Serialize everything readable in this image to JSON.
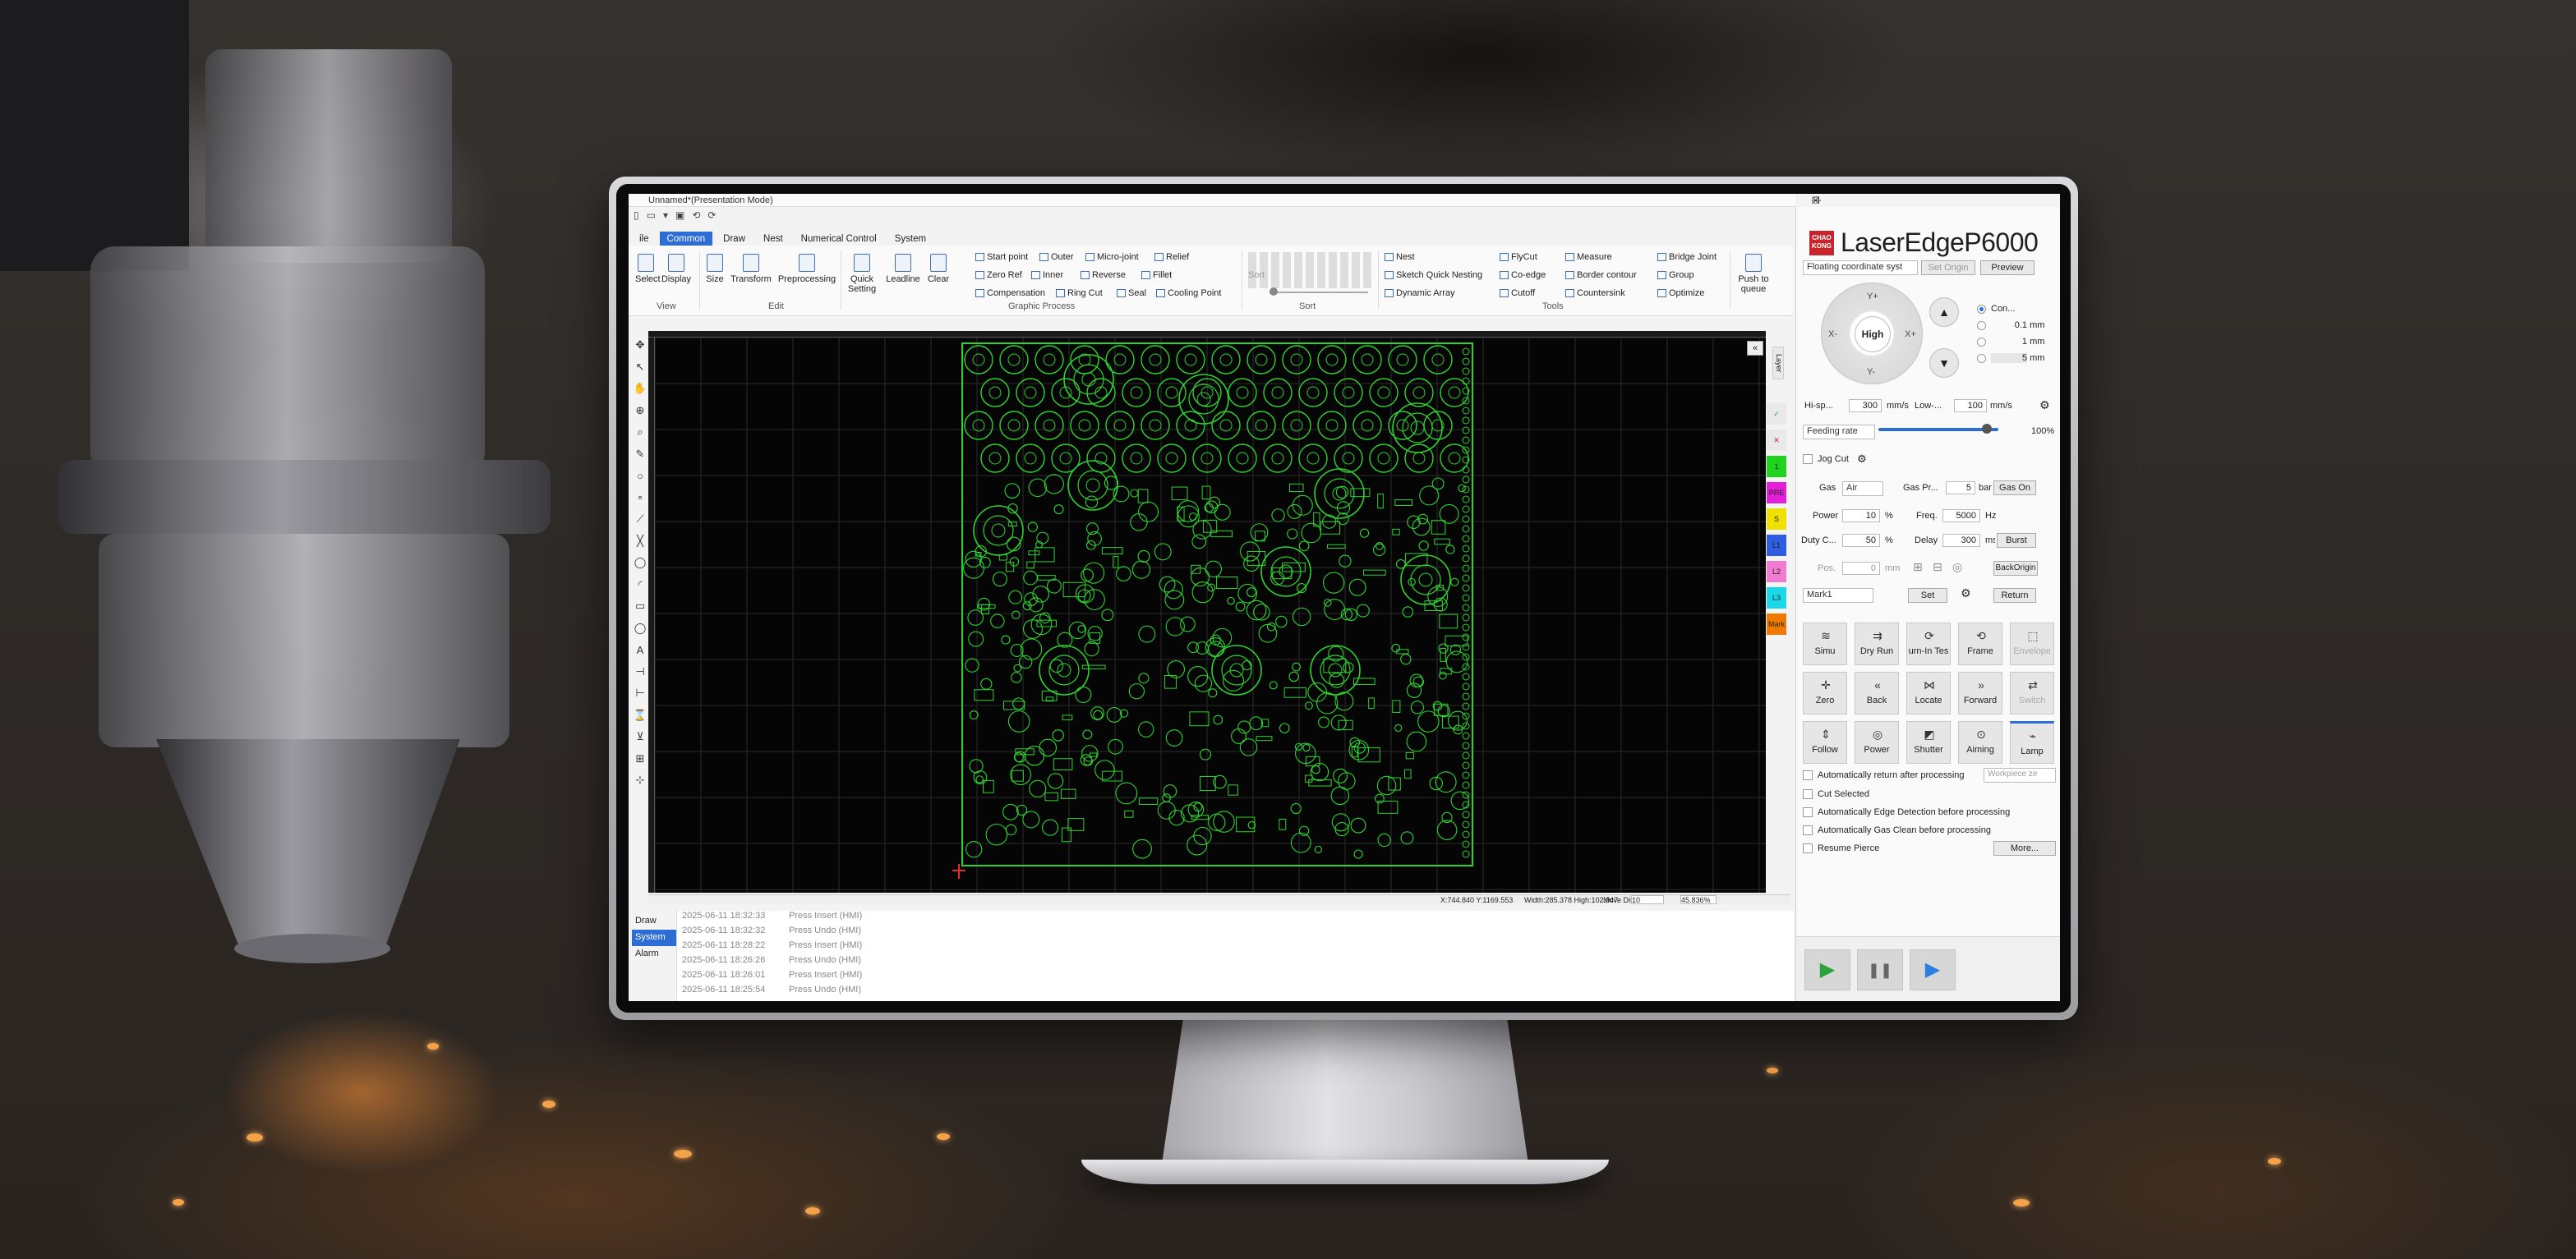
{
  "window": {
    "title": "Unnamed*(Presentation Mode)",
    "controls": [
      "—",
      "❐",
      "✕"
    ]
  },
  "quick_access": [
    "▯",
    "▭",
    "▾",
    "▣",
    "⟲",
    "⟳"
  ],
  "tabs": [
    {
      "label": "ile",
      "active": false
    },
    {
      "label": "Common",
      "active": true
    },
    {
      "label": "Draw",
      "active": false
    },
    {
      "label": "Nest",
      "active": false
    },
    {
      "label": "Numerical Control",
      "active": false
    },
    {
      "label": "System",
      "active": false
    }
  ],
  "ribbon": {
    "groups": {
      "view": "View",
      "edit": "Edit",
      "graphic_process": "Graphic Process",
      "sort": "Sort",
      "tools": "Tools"
    },
    "view": {
      "select": "Select",
      "display": "Display"
    },
    "edit": {
      "size": "Size",
      "transform": "Transform",
      "preprocessing": "Preprocessing"
    },
    "gp": {
      "quick_setting": "Quick Setting",
      "leadline": "Leadline",
      "clear": "Clear",
      "start_point": "Start point",
      "outer": "Outer",
      "micro_joint": "Micro-joint",
      "relief": "Relief",
      "zero_ref": "Zero Ref",
      "inner": "Inner",
      "reverse": "Reverse",
      "fillet": "Fillet",
      "compensation": "Compensation",
      "ring_cut": "Ring Cut",
      "seal": "Seal",
      "cooling_point": "Cooling Point"
    },
    "sort": {
      "label": "Sort"
    },
    "tools": {
      "nest": "Nest",
      "sketch_quick_nesting": "Sketch Quick Nesting",
      "dynamic_array": "Dynamic Array",
      "flycut": "FlyCut",
      "co_edge": "Co-edge",
      "cutoff": "Cutoff",
      "measure": "Measure",
      "border_contour": "Border contour",
      "countersink": "Countersink",
      "bridge_joint": "Bridge Joint",
      "group": "Group",
      "optimize": "Optimize"
    },
    "push_to_queue": "Push to queue"
  },
  "left_tools": [
    "✥",
    "↖",
    "✋",
    "⊕",
    "⌕",
    "✎",
    "○",
    "∘",
    "⟋",
    "╳",
    "◯",
    "◜",
    "▭",
    "◯",
    "A",
    "⊣",
    "⊢",
    "⌛",
    "⊻",
    "⊞",
    "⊹"
  ],
  "layers": [
    {
      "label": "✓",
      "color": "#e9e9e9",
      "text": "#2ca02c"
    },
    {
      "label": "✕",
      "color": "#e9e9e9",
      "text": "#d62728"
    },
    {
      "label": "1",
      "color": "#1fd31f",
      "text": "#222"
    },
    {
      "label": "PRE",
      "color": "#e320d8",
      "text": "#222"
    },
    {
      "label": "S",
      "color": "#f0e000",
      "text": "#222"
    },
    {
      "label": "L1",
      "color": "#2f5de0",
      "text": "#222"
    },
    {
      "label": "L2",
      "color": "#f07bd0",
      "text": "#222"
    },
    {
      "label": "L3",
      "color": "#1ad8e8",
      "text": "#222"
    },
    {
      "label": "Mark",
      "color": "#f07a00",
      "text": "#222"
    }
  ],
  "layer_tab": "Layer",
  "canvas": {
    "close_icon": "«",
    "pattern_color": "#2fd32f",
    "grid_color": "#2a2a2a"
  },
  "status_bar": {
    "coords": "X:744.840 Y:1169.553",
    "size": "Width:285.378 High:102.947",
    "move_dis_label": "Move Dis",
    "move_dis_value": "10",
    "zoom": "45.836%"
  },
  "log": {
    "tabs": [
      {
        "label": "Draw",
        "active": false
      },
      {
        "label": "System",
        "active": true
      },
      {
        "label": "Alarm",
        "active": false
      }
    ],
    "rows": [
      {
        "time": "2025-06-11 18:32:33",
        "msg": "Press Insert (HMI)"
      },
      {
        "time": "2025-06-11 18:32:32",
        "msg": "Press Undo (HMI)"
      },
      {
        "time": "2025-06-11 18:28:22",
        "msg": "Press Insert (HMI)"
      },
      {
        "time": "2025-06-11 18:26:26",
        "msg": "Press Undo (HMI)"
      },
      {
        "time": "2025-06-11 18:26:01",
        "msg": "Press Insert (HMI)"
      },
      {
        "time": "2025-06-11 18:25:54",
        "msg": "Press Undo (HMI)"
      }
    ]
  },
  "panel": {
    "logo_mark": "CHAO KONG",
    "brand": "LaserEdge",
    "model": "P6000",
    "coord_system": "Floating coordinate syst",
    "set_origin": "Set Origin",
    "preview": "Preview",
    "jog": {
      "up": "Y+",
      "down": "Y-",
      "left": "X-",
      "right": "X+",
      "center": "High"
    },
    "step_options": [
      {
        "label": "Con...",
        "on": true
      },
      {
        "label": "0.1",
        "unit": "mm",
        "on": false
      },
      {
        "label": "1",
        "unit": "mm",
        "on": false
      },
      {
        "label": "5",
        "unit": "mm",
        "on": false
      }
    ],
    "hi_speed": {
      "label": "Hi-sp...",
      "value": "300",
      "unit": "mm/s"
    },
    "low_speed": {
      "label": "Low-...",
      "value": "100",
      "unit": "mm/s"
    },
    "feeding_rate": {
      "label": "Feeding rate",
      "percent": "100%",
      "fraction": 0.9
    },
    "jog_cut": "Jog Cut",
    "gas": {
      "label": "Gas",
      "value": "Air",
      "pressure_label": "Gas Pr...",
      "pressure": "5",
      "unit": "bar",
      "button": "Gas On"
    },
    "power": {
      "label": "Power",
      "value": "10",
      "unit": "%"
    },
    "freq": {
      "label": "Freq.",
      "value": "5000",
      "unit": "Hz"
    },
    "duty": {
      "label": "Duty C...",
      "value": "50",
      "unit": "%"
    },
    "delay": {
      "label": "Delay",
      "value": "300",
      "unit": "ms"
    },
    "burst": "Burst",
    "pos": {
      "label": "Pos.",
      "value": "0",
      "unit": "mm"
    },
    "back_origin": "BackOrigin",
    "mark": "Mark1",
    "set": "Set",
    "return": "Return",
    "actions": [
      {
        "label": "Simu",
        "icon": "≋",
        "enabled": true
      },
      {
        "label": "Dry Run",
        "icon": "⇉",
        "enabled": true
      },
      {
        "label": "urn-In Tes",
        "icon": "⟳",
        "enabled": true
      },
      {
        "label": "Frame",
        "icon": "⟲",
        "enabled": true
      },
      {
        "label": "Envelope",
        "icon": "⬚",
        "enabled": false
      },
      {
        "label": "Zero",
        "icon": "✛",
        "enabled": true
      },
      {
        "label": "Back",
        "icon": "«",
        "enabled": true
      },
      {
        "label": "Locate",
        "icon": "⋈",
        "enabled": true
      },
      {
        "label": "Forward",
        "icon": "»",
        "enabled": true
      },
      {
        "label": "Switch",
        "icon": "⇄",
        "enabled": false
      },
      {
        "label": "Follow",
        "icon": "⇕",
        "enabled": true
      },
      {
        "label": "Power",
        "icon": "◎",
        "enabled": true
      },
      {
        "label": "Shutter",
        "icon": "◩",
        "enabled": true
      },
      {
        "label": "Aiming",
        "icon": "⊙",
        "enabled": true
      },
      {
        "label": "Lamp",
        "icon": "⌁",
        "enabled": true
      }
    ],
    "auto_return": "Automatically return after processing",
    "workpiece": "Workpiece ze",
    "options": [
      "Cut Selected",
      "Automatically Edge Detection before processing",
      "Automatically Gas Clean before processing",
      "Resume Pierce"
    ],
    "more": "More...",
    "play_buttons": [
      {
        "icon": "▶",
        "color": "#2ca23a"
      },
      {
        "icon": "❚❚",
        "color": "#666"
      },
      {
        "icon": "▶",
        "color": "#2c7ee0"
      }
    ]
  }
}
